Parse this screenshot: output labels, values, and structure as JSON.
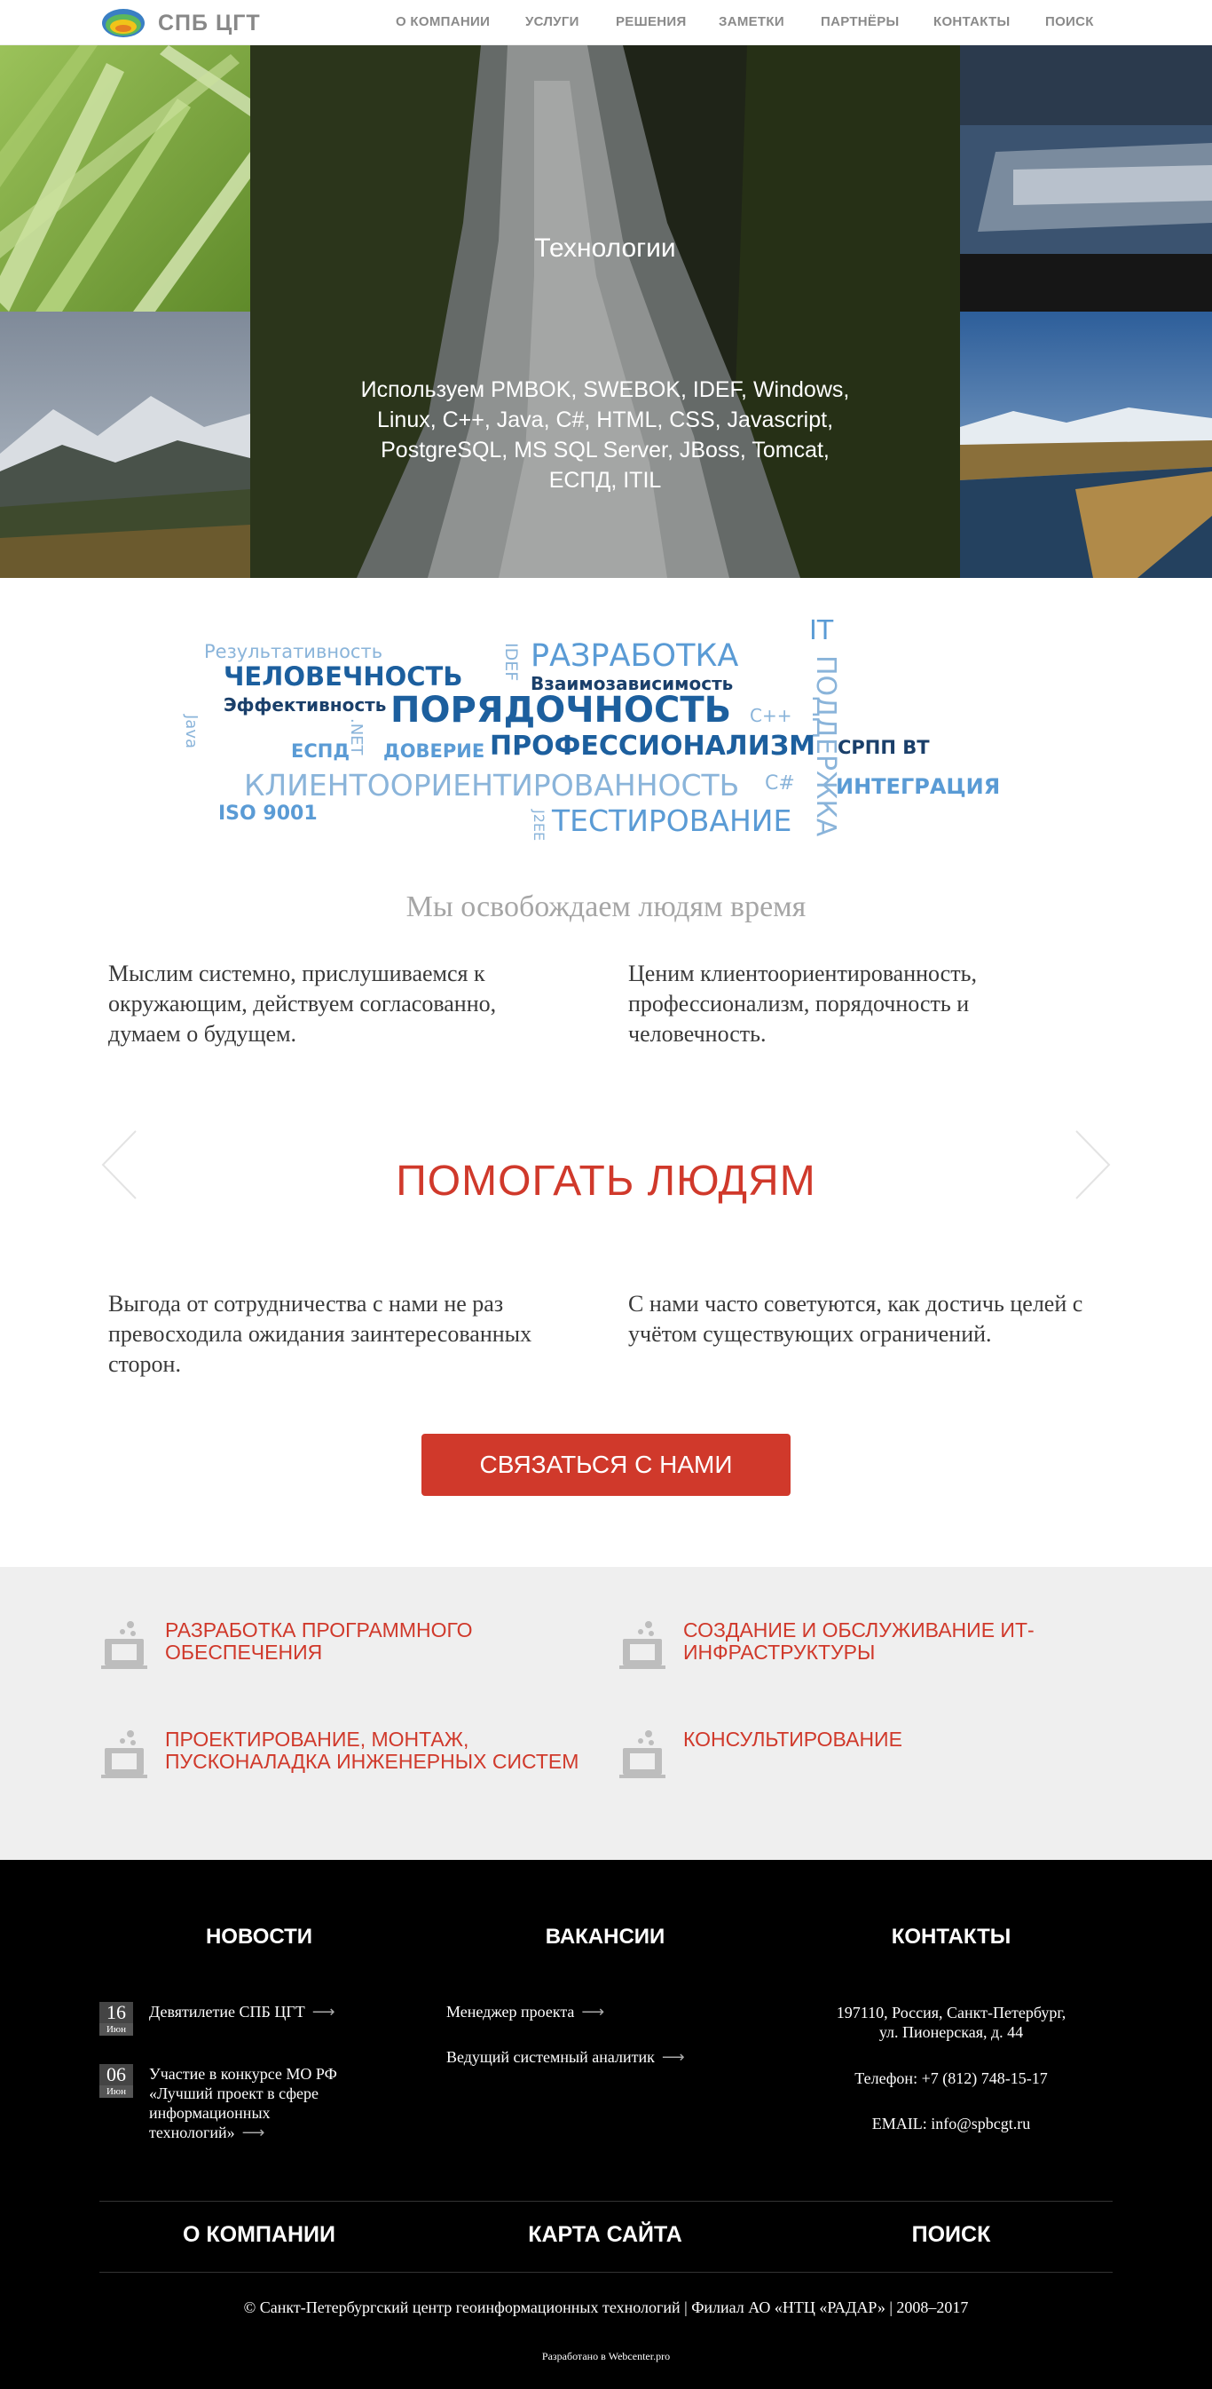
{
  "header": {
    "logo_text": "СПБ ЦГТ",
    "nav": [
      "О КОМПАНИИ",
      "УСЛУГИ",
      "РЕШЕНИЯ",
      "ЗАМЕТКИ",
      "ПАРТНЁРЫ",
      "КОНТАКТЫ",
      "ПОИСК"
    ]
  },
  "hero": {
    "title": "Технологии",
    "text": "Используем PMBOK, SWEBOK, IDEF, Windows, Linux, C++, Java, C#, HTML, CSS, Javascript, PostgreSQL, MS SQL Server, JBoss, Tomcat, ЕСПД, ITIL"
  },
  "word_cloud": {
    "words": [
      "Результативность",
      "ЧЕЛОВЕЧНОСТЬ",
      "Эффективность",
      "Java",
      "IDEF",
      "РАЗРАБОТКА",
      "Взаимозависимость",
      "ПОРЯДОЧНОСТЬ",
      "IT",
      "ПОДДЕРЖКА",
      "C++",
      "ЕСПД",
      ".NET",
      "ДОВЕРИЕ",
      "ПРОФЕССИОНАЛИЗМ",
      "СРПП ВТ",
      "КЛИЕНТООРИЕНТИРОВАННОСТЬ",
      "C#",
      "ИНТЕГРАЦИЯ",
      "ISO 9001",
      "J2EE",
      "ТЕСТИРОВАНИЕ"
    ]
  },
  "about": {
    "tagline": "Мы освобождаем людям время",
    "left": "Мыслим системно, прислушиваемся к окружающим, действуем согласованно, думаем о будущем.",
    "right": "Ценим клиентоориентированность, профессионализм, порядочность и человечность."
  },
  "slider": {
    "title": "ПОМОГАТЬ ЛЮДЯМ",
    "left": "Выгода от сотрудничества с нами не раз превосходила ожидания заинтересованных сторон.",
    "right": "С нами часто советуются, как достичь целей с учётом существующих ограничений."
  },
  "cta": {
    "label": "СВЯЗАТЬСЯ С НАМИ"
  },
  "services": [
    "РАЗРАБОТКА ПРОГРАММНОГО ОБЕСПЕЧЕНИЯ",
    "СОЗДАНИЕ И ОБСЛУЖИВАНИЕ ИТ-ИНФРАСТРУКТУРЫ",
    "ПРОЕКТИРОВАНИЕ, МОНТАЖ, ПУСКОНАЛАДКА ИНЖЕНЕРНЫХ СИСТЕМ",
    "КОНСУЛЬТИРОВАНИЕ"
  ],
  "footer": {
    "news_title": "НОВОСТИ",
    "vacancies_title": "ВАКАНСИИ",
    "contacts_title": "КОНТАКТЫ",
    "news": [
      {
        "day": "16",
        "month": "Июн",
        "text": "Девятилетие СПБ ЦГТ"
      },
      {
        "day": "06",
        "month": "Июн",
        "text": "Участие в конкурсе МО РФ «Лучший проект в сфере информационных технологий»"
      }
    ],
    "vacancies": [
      "Менеджер проекта",
      "Ведущий системный аналитик"
    ],
    "contacts": {
      "address_1": "197110, Россия, Санкт-Петербург,",
      "address_2": "ул. Пионерская, д. 44",
      "phone": "Телефон: +7 (812) 748-15-17",
      "email": "EMAIL: info@spbcgt.ru"
    },
    "links": [
      "О КОМПАНИИ",
      "КАРТА САЙТА",
      "ПОИСК"
    ],
    "copyright": "© Санкт-Петербургский центр геоинформационных технологий | Филиал АО «НТЦ «РАДАР» | 2008–2017",
    "developer": "Разработано в Webcenter.pro"
  },
  "colors": {
    "accent": "#d0392b",
    "footer_bg": "#000000",
    "services_bg": "#efefef",
    "cloud_dark": "#1c5f9e",
    "cloud_light": "#8ab4da"
  }
}
